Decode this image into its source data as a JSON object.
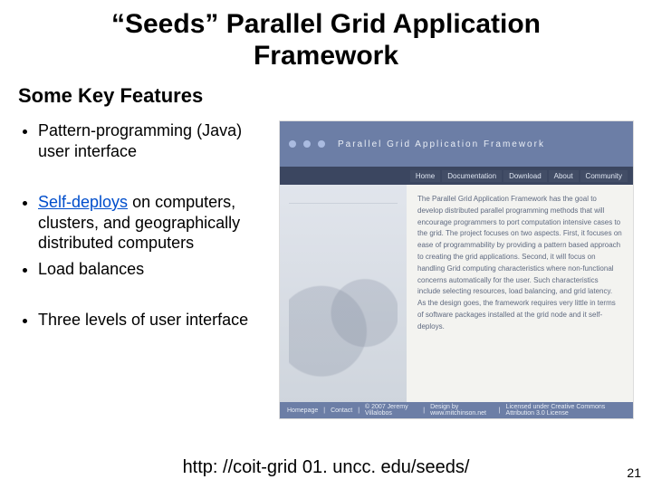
{
  "title_line1": "“Seeds” Parallel Grid Application",
  "title_line2": "Framework",
  "subtitle": "Some Key Features",
  "bullets": {
    "b1": "Pattern-programming (Java) user interface",
    "b2_pre": "Self-deploys",
    "b2_rest": " on computers, clusters, and geographically distributed computers",
    "b3": "Load balances",
    "b4": "Three levels of user interface"
  },
  "screenshot": {
    "banner": "Parallel Grid Application Framework",
    "nav": {
      "n1": "Home",
      "n2": "Documentation",
      "n3": "Download",
      "n4": "About",
      "n5": "Community"
    },
    "para": "The Parallel Grid Application Framework has the goal to develop distributed parallel programming methods that will encourage programmers to port computation intensive cases to the grid. The project focuses on two aspects. First, it focuses on ease of programmability by providing a pattern based approach to creating the grid applications. Second, it will focus on handling Grid computing characteristics where non-functional concerns automatically for the user. Such characteristics include selecting resources, load balancing, and grid latency. As the design goes, the framework requires very little in terms of software packages installed at the grid node and it self-deploys.",
    "footer": {
      "f1": "Homepage",
      "f2": "Contact",
      "f3": "© 2007 Jeremy Villalobos",
      "f4": "Design by www.mitchinson.net",
      "f5": "Licensed under Creative Commons Attribution 3.0 License"
    }
  },
  "url": "http: //coit-grid 01. uncc. edu/seeds/",
  "page_number": "21"
}
